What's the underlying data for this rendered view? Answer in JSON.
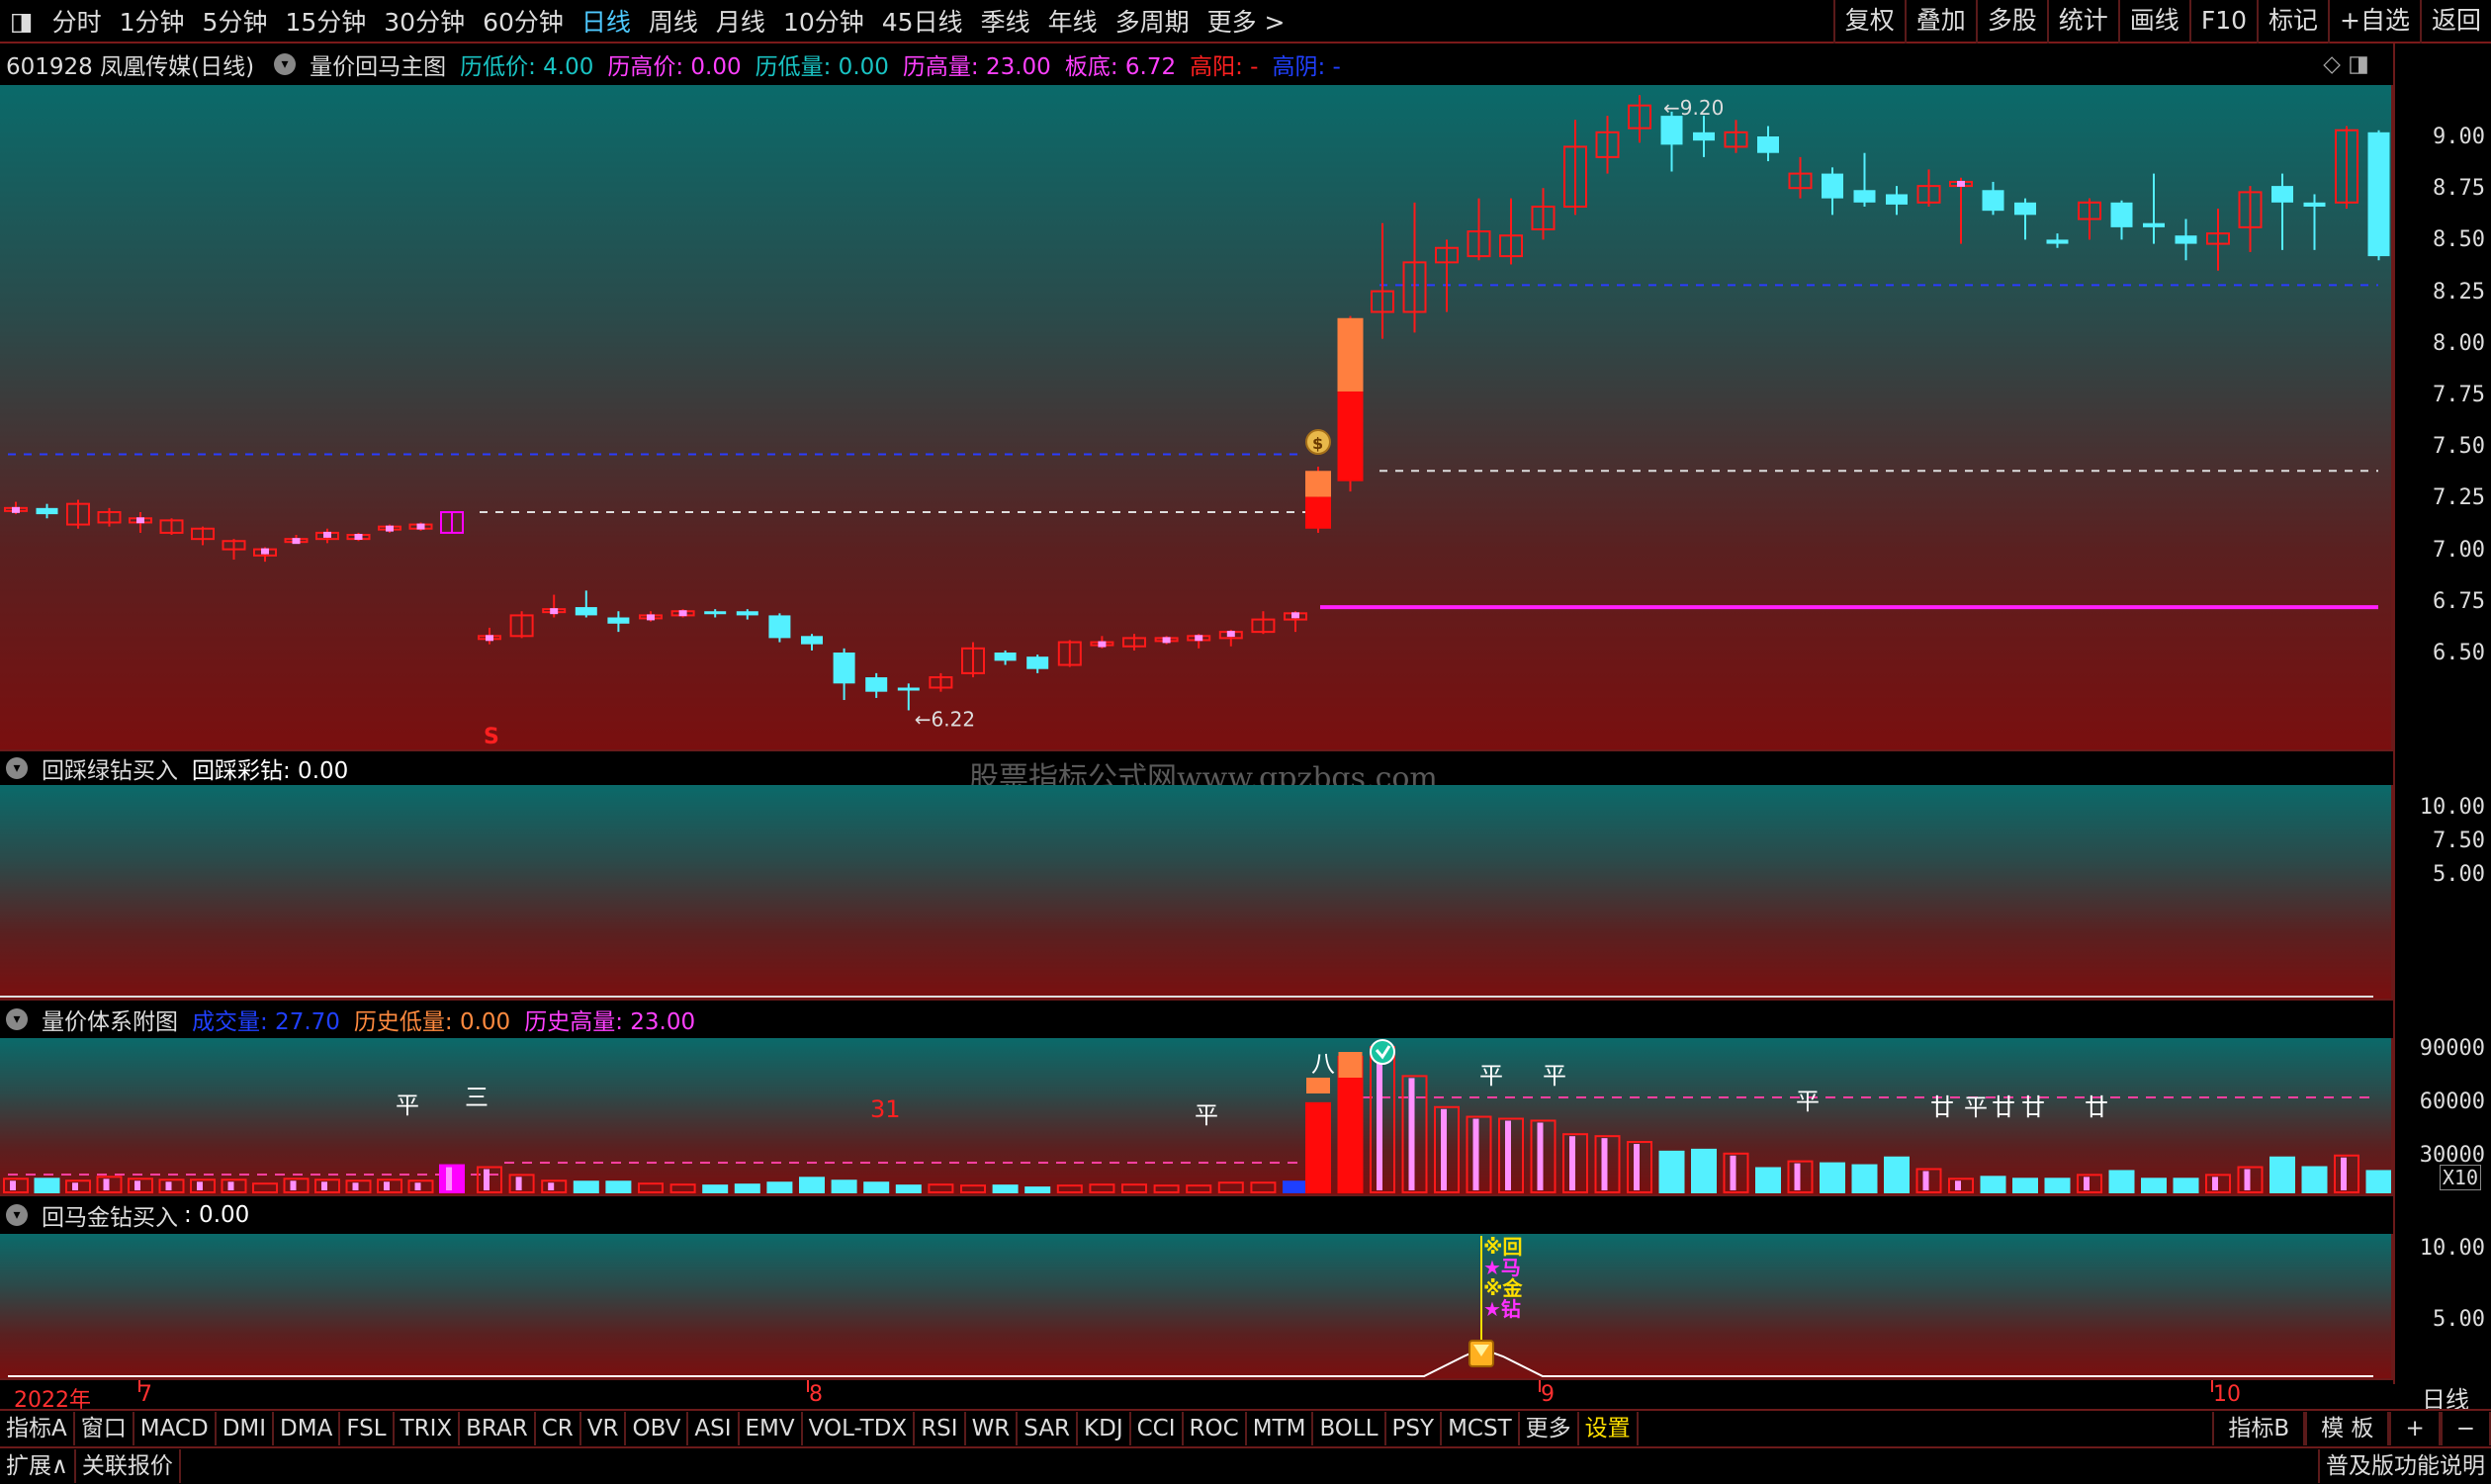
{
  "toolbar": {
    "periods": [
      "分时",
      "1分钟",
      "5分钟",
      "15分钟",
      "30分钟",
      "60分钟",
      "日线",
      "周线",
      "月线",
      "10分钟",
      "45日线",
      "季线",
      "年线",
      "多周期",
      "更多 >"
    ],
    "active_period": "日线",
    "right": [
      "复权",
      "叠加",
      "多股",
      "统计",
      "画线",
      "F10",
      "标记",
      "+自选",
      "返回"
    ]
  },
  "main_info": {
    "stock": "601928 凤凰传媒(日线)",
    "indicator": "量价回马主图",
    "low_price_label": "历低价: 4.00",
    "high_price_label": "历高价: 0.00",
    "low_vol_label": "历低量: 0.00",
    "high_vol_label": "历高量: 23.00",
    "bottom_label": "板底: 6.72",
    "highyang_label": "高阳: -",
    "highyin_label": "高阴: -"
  },
  "colors": {
    "cyan": "#54f0ff",
    "red": "#ff1010",
    "magenta": "#ff00ff",
    "orange": "#ff7f3f",
    "blue": "#1e3fff",
    "yellow": "#ffe000"
  },
  "price_axis": [
    "9.00",
    "8.75",
    "8.50",
    "8.25",
    "8.00",
    "7.75",
    "7.50",
    "7.25",
    "7.00",
    "6.75",
    "6.50"
  ],
  "price_annotations": {
    "high": "9.20",
    "low": "6.22",
    "signal_s": "S"
  },
  "panel2": {
    "title": "回踩绿钻买入",
    "value_label": "回踩彩钻: 0.00",
    "axis": [
      "10.00",
      "7.50",
      "5.00"
    ]
  },
  "watermark": "股票指标公式网www.gpzbgs.com",
  "panel3": {
    "title": "量价体系附图",
    "vol_label": "成交量: 27.70",
    "low_label": "历史低量: 0.00",
    "high_label": "历史高量: 23.00",
    "axis": [
      "90000",
      "60000",
      "30000"
    ],
    "unit": "X10",
    "marks": [
      "平",
      "三",
      "31",
      "平",
      "八",
      "平",
      "平",
      "平",
      "廿",
      "平",
      "廿",
      "廿",
      "廿"
    ]
  },
  "panel4": {
    "title": "回马金钻买入",
    "value_label": ": 0.00",
    "axis": [
      "10.00",
      "5.00"
    ],
    "signal_lines": [
      "※回",
      "★马",
      "※金",
      "★钻"
    ]
  },
  "date_axis": {
    "labels": [
      "2022年",
      "7",
      "8",
      "9",
      "10"
    ],
    "period": "日线"
  },
  "tabs": [
    "指标A",
    "窗口",
    "MACD",
    "DMI",
    "DMA",
    "FSL",
    "TRIX",
    "BRAR",
    "CR",
    "VR",
    "OBV",
    "ASI",
    "EMV",
    "VOL-TDX",
    "RSI",
    "WR",
    "SAR",
    "KDJ",
    "CCI",
    "ROC",
    "MTM",
    "BOLL",
    "PSY",
    "MCST",
    "更多",
    "设置"
  ],
  "selected_tab": "设置",
  "tabs_right": [
    "指标B",
    "模 板",
    "+",
    "−"
  ],
  "status": {
    "left1": "扩展∧",
    "left2": "关联报价",
    "right": "普及版功能说明"
  },
  "chart_data": {
    "type": "candlestick",
    "title": "601928 凤凰传媒(日线)",
    "ylim": [
      6.22,
      9.2
    ],
    "x_month_labels": [
      "7",
      "8",
      "9",
      "10"
    ],
    "candles": [
      {
        "o": 7.2,
        "c": 7.2,
        "h": 7.23,
        "l": 7.17
      },
      {
        "o": 7.2,
        "c": 7.17,
        "h": 7.22,
        "l": 7.15
      },
      {
        "o": 7.12,
        "c": 7.22,
        "h": 7.24,
        "l": 7.1
      },
      {
        "o": 7.13,
        "c": 7.18,
        "h": 7.2,
        "l": 7.11
      },
      {
        "o": 7.13,
        "c": 7.15,
        "h": 7.18,
        "l": 7.08
      },
      {
        "o": 7.08,
        "c": 7.14,
        "h": 7.15,
        "l": 7.07
      },
      {
        "o": 7.05,
        "c": 7.1,
        "h": 7.11,
        "l": 7.02
      },
      {
        "o": 7.0,
        "c": 7.04,
        "h": 7.05,
        "l": 6.95
      },
      {
        "o": 6.97,
        "c": 7.0,
        "h": 7.01,
        "l": 6.94
      },
      {
        "o": 7.04,
        "c": 7.05,
        "h": 7.07,
        "l": 7.03
      },
      {
        "o": 7.05,
        "c": 7.08,
        "h": 7.1,
        "l": 7.03
      },
      {
        "o": 7.05,
        "c": 7.07,
        "h": 7.08,
        "l": 7.04
      },
      {
        "o": 7.1,
        "c": 7.11,
        "h": 7.12,
        "l": 7.08
      },
      {
        "o": 7.1,
        "c": 7.12,
        "h": 7.13,
        "l": 7.09
      },
      {
        "o": 7.08,
        "c": 7.18,
        "h": 7.18,
        "l": 7.08
      },
      {
        "o": 6.58,
        "c": 6.58,
        "h": 6.62,
        "l": 6.54
      },
      {
        "o": 6.58,
        "c": 6.68,
        "h": 6.7,
        "l": 6.57
      },
      {
        "o": 6.7,
        "c": 6.71,
        "h": 6.78,
        "l": 6.67
      },
      {
        "o": 6.72,
        "c": 6.68,
        "h": 6.8,
        "l": 6.67
      },
      {
        "o": 6.67,
        "c": 6.64,
        "h": 6.7,
        "l": 6.6
      },
      {
        "o": 6.67,
        "c": 6.68,
        "h": 6.7,
        "l": 6.65
      },
      {
        "o": 6.68,
        "c": 6.7,
        "h": 6.71,
        "l": 6.67
      },
      {
        "o": 6.7,
        "c": 6.69,
        "h": 6.71,
        "l": 6.67
      },
      {
        "o": 6.7,
        "c": 6.68,
        "h": 6.71,
        "l": 6.66
      },
      {
        "o": 6.68,
        "c": 6.57,
        "h": 6.69,
        "l": 6.55
      },
      {
        "o": 6.58,
        "c": 6.54,
        "h": 6.59,
        "l": 6.51
      },
      {
        "o": 6.5,
        "c": 6.35,
        "h": 6.52,
        "l": 6.27
      },
      {
        "o": 6.38,
        "c": 6.31,
        "h": 6.4,
        "l": 6.28
      },
      {
        "o": 6.33,
        "c": 6.32,
        "h": 6.35,
        "l": 6.22
      },
      {
        "o": 6.33,
        "c": 6.38,
        "h": 6.4,
        "l": 6.31
      },
      {
        "o": 6.4,
        "c": 6.52,
        "h": 6.55,
        "l": 6.38
      },
      {
        "o": 6.5,
        "c": 6.46,
        "h": 6.51,
        "l": 6.44
      },
      {
        "o": 6.48,
        "c": 6.42,
        "h": 6.49,
        "l": 6.4
      },
      {
        "o": 6.44,
        "c": 6.55,
        "h": 6.56,
        "l": 6.43
      },
      {
        "o": 6.54,
        "c": 6.55,
        "h": 6.58,
        "l": 6.52
      },
      {
        "o": 6.53,
        "c": 6.57,
        "h": 6.59,
        "l": 6.51
      },
      {
        "o": 6.56,
        "c": 6.57,
        "h": 6.58,
        "l": 6.54
      },
      {
        "o": 6.56,
        "c": 6.58,
        "h": 6.59,
        "l": 6.52
      },
      {
        "o": 6.57,
        "c": 6.6,
        "h": 6.61,
        "l": 6.53
      },
      {
        "o": 6.6,
        "c": 6.66,
        "h": 6.7,
        "l": 6.59
      },
      {
        "o": 6.66,
        "c": 6.69,
        "h": 6.7,
        "l": 6.6
      },
      {
        "o": 7.1,
        "c": 7.38,
        "h": 7.4,
        "l": 7.08
      },
      {
        "o": 7.33,
        "c": 8.12,
        "h": 8.13,
        "l": 7.28
      },
      {
        "o": 8.15,
        "c": 8.25,
        "h": 8.58,
        "l": 8.02
      },
      {
        "o": 8.15,
        "c": 8.39,
        "h": 8.68,
        "l": 8.05
      },
      {
        "o": 8.39,
        "c": 8.46,
        "h": 8.5,
        "l": 8.15
      },
      {
        "o": 8.42,
        "c": 8.54,
        "h": 8.7,
        "l": 8.4
      },
      {
        "o": 8.42,
        "c": 8.52,
        "h": 8.7,
        "l": 8.38
      },
      {
        "o": 8.55,
        "c": 8.66,
        "h": 8.75,
        "l": 8.5
      },
      {
        "o": 8.66,
        "c": 8.95,
        "h": 9.08,
        "l": 8.62
      },
      {
        "o": 8.9,
        "c": 9.02,
        "h": 9.1,
        "l": 8.82
      },
      {
        "o": 9.04,
        "c": 9.15,
        "h": 9.2,
        "l": 8.97
      },
      {
        "o": 9.1,
        "c": 8.96,
        "h": 9.12,
        "l": 8.83
      },
      {
        "o": 9.02,
        "c": 8.98,
        "h": 9.1,
        "l": 8.9
      },
      {
        "o": 8.95,
        "c": 9.02,
        "h": 9.08,
        "l": 8.92
      },
      {
        "o": 9.0,
        "c": 8.92,
        "h": 9.05,
        "l": 8.88
      },
      {
        "o": 8.75,
        "c": 8.82,
        "h": 8.9,
        "l": 8.7
      },
      {
        "o": 8.82,
        "c": 8.7,
        "h": 8.85,
        "l": 8.62
      },
      {
        "o": 8.74,
        "c": 8.68,
        "h": 8.92,
        "l": 8.66
      },
      {
        "o": 8.72,
        "c": 8.67,
        "h": 8.76,
        "l": 8.62
      },
      {
        "o": 8.68,
        "c": 8.76,
        "h": 8.84,
        "l": 8.66
      },
      {
        "o": 8.76,
        "c": 8.78,
        "h": 8.8,
        "l": 8.48
      },
      {
        "o": 8.74,
        "c": 8.64,
        "h": 8.78,
        "l": 8.62
      },
      {
        "o": 8.68,
        "c": 8.62,
        "h": 8.7,
        "l": 8.5
      },
      {
        "o": 8.5,
        "c": 8.48,
        "h": 8.53,
        "l": 8.46
      },
      {
        "o": 8.6,
        "c": 8.68,
        "h": 8.7,
        "l": 8.5
      },
      {
        "o": 8.68,
        "c": 8.56,
        "h": 8.69,
        "l": 8.5
      },
      {
        "o": 8.58,
        "c": 8.56,
        "h": 8.82,
        "l": 8.48
      },
      {
        "o": 8.52,
        "c": 8.48,
        "h": 8.6,
        "l": 8.4
      },
      {
        "o": 8.48,
        "c": 8.53,
        "h": 8.65,
        "l": 8.35
      },
      {
        "o": 8.56,
        "c": 8.73,
        "h": 8.76,
        "l": 8.44
      },
      {
        "o": 8.76,
        "c": 8.68,
        "h": 8.82,
        "l": 8.45
      },
      {
        "o": 8.68,
        "c": 8.66,
        "h": 8.72,
        "l": 8.45
      },
      {
        "o": 8.68,
        "c": 9.03,
        "h": 9.05,
        "l": 8.65
      },
      {
        "o": 9.02,
        "c": 8.42,
        "h": 9.03,
        "l": 8.4
      }
    ],
    "levels": {
      "blue_dashed_left": 7.46,
      "gray_dashed_left": 7.18,
      "gray_dashed_right": 7.38,
      "blue_dashed_right": 8.28,
      "magenta_line": 6.72
    }
  }
}
